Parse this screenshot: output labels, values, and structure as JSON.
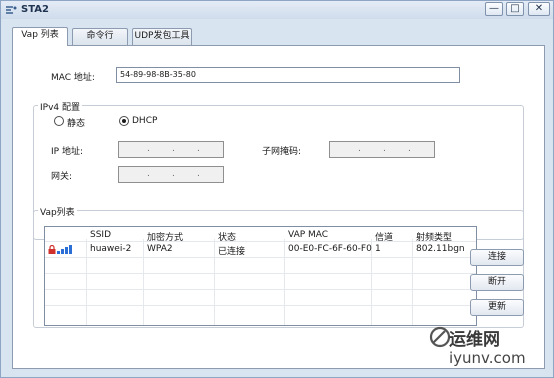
{
  "window": {
    "title": "STA2",
    "controls": {
      "minimize": "—",
      "maximize": "□",
      "close": "✕"
    }
  },
  "tabs": [
    {
      "label": "Vap 列表",
      "active": true
    },
    {
      "label": "命令行",
      "active": false
    },
    {
      "label": "UDP发包工具",
      "active": false
    }
  ],
  "mac": {
    "label": "MAC 地址:",
    "value": "54-89-98-8B-35-80"
  },
  "ipv4": {
    "legend": "IPv4 配置",
    "static_label": "静态",
    "dhcp_label": "DHCP",
    "selected": "DHCP",
    "ip_label": "IP 地址:",
    "mask_label": "子网掩码:",
    "gateway_label": "网关:",
    "dot": "."
  },
  "vap": {
    "legend": "Vap列表",
    "columns": [
      "SSID",
      "加密方式",
      "状态",
      "VAP MAC",
      "信道",
      "射频类型"
    ],
    "rows": [
      {
        "ssid": "huawei-2",
        "encryption": "WPA2",
        "status": "已连接",
        "vap_mac": "00-E0-FC-6F-60-F0",
        "channel": "1",
        "radio": "802.11bgn",
        "icons": [
          "lock-icon",
          "signal-icon"
        ]
      }
    ]
  },
  "buttons": {
    "connect": "连接",
    "disconnect": "断开",
    "refresh": "更新"
  },
  "watermark": {
    "line1": "运维网",
    "line2": "iyunv.com"
  },
  "colors": {
    "frame": "#8ea6c4",
    "title_bg": "#d9e4f1",
    "lock": "#d0312d",
    "signal": "#2b6fd6"
  }
}
